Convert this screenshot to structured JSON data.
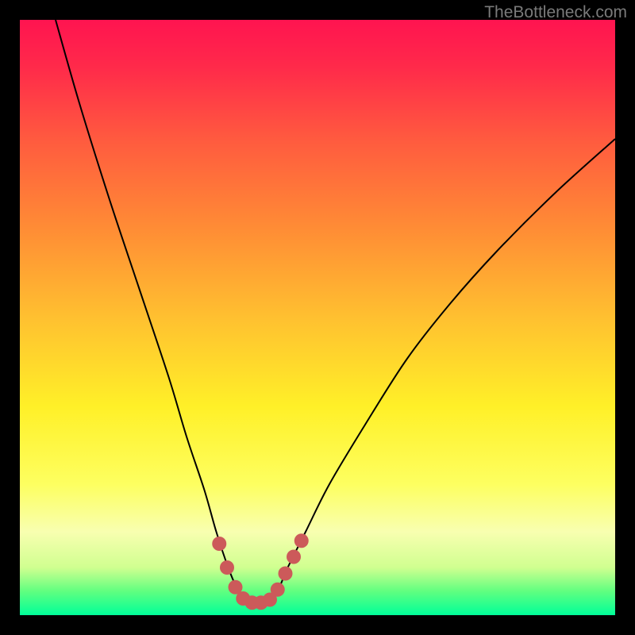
{
  "watermark": "TheBottleneck.com",
  "chart_data": {
    "type": "line",
    "title": "",
    "xlabel": "",
    "ylabel": "",
    "xlim": [
      0,
      100
    ],
    "ylim": [
      0,
      100
    ],
    "curve": {
      "name": "bottleneck-curve",
      "x": [
        6,
        10,
        15,
        20,
        25,
        28,
        31,
        33,
        35,
        36.5,
        38,
        40,
        42,
        43.5,
        45,
        48,
        52,
        58,
        65,
        72,
        80,
        90,
        100
      ],
      "y": [
        100,
        86,
        70,
        55,
        40,
        30,
        21,
        14,
        8,
        4.5,
        2.5,
        2,
        2.5,
        4.5,
        8,
        14,
        22,
        32,
        43,
        52,
        61,
        71,
        80
      ]
    },
    "highlight": {
      "name": "sweet-spot-dots",
      "color": "#cc5a5a",
      "points": [
        {
          "x": 33.5,
          "y": 12
        },
        {
          "x": 34.8,
          "y": 8
        },
        {
          "x": 36.2,
          "y": 4.7
        },
        {
          "x": 37.5,
          "y": 2.8
        },
        {
          "x": 39,
          "y": 2.1
        },
        {
          "x": 40.5,
          "y": 2.1
        },
        {
          "x": 42,
          "y": 2.6
        },
        {
          "x": 43.3,
          "y": 4.3
        },
        {
          "x": 44.6,
          "y": 7
        },
        {
          "x": 46,
          "y": 9.8
        },
        {
          "x": 47.3,
          "y": 12.5
        }
      ]
    }
  }
}
